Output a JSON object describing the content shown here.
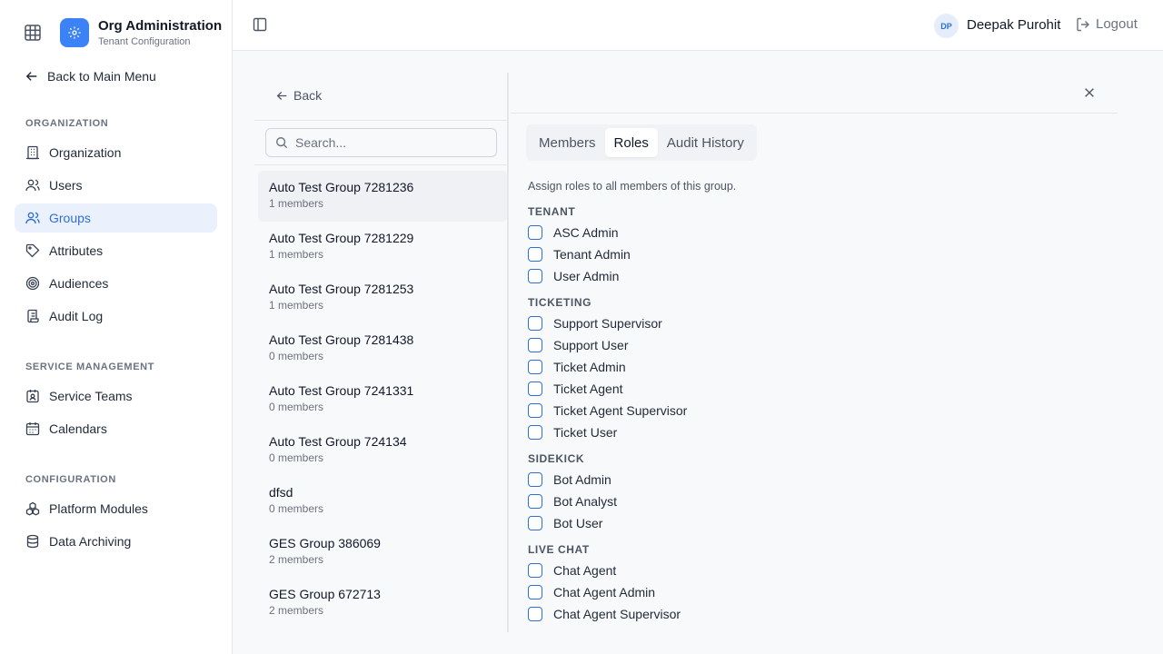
{
  "app": {
    "title": "Org Administration",
    "subtitle": "Tenant Configuration"
  },
  "sidebar": {
    "back_label": "Back to Main Menu",
    "sections": [
      {
        "label": "ORGANIZATION",
        "items": [
          {
            "label": "Organization",
            "icon": "building-icon"
          },
          {
            "label": "Users",
            "icon": "users-icon"
          },
          {
            "label": "Groups",
            "icon": "group-icon",
            "active": true
          },
          {
            "label": "Attributes",
            "icon": "tag-icon"
          },
          {
            "label": "Audiences",
            "icon": "target-icon"
          },
          {
            "label": "Audit Log",
            "icon": "scroll-icon"
          }
        ]
      },
      {
        "label": "SERVICE MANAGEMENT",
        "items": [
          {
            "label": "Service Teams",
            "icon": "team-badge-icon"
          },
          {
            "label": "Calendars",
            "icon": "calendar-icon"
          }
        ]
      },
      {
        "label": "CONFIGURATION",
        "items": [
          {
            "label": "Platform Modules",
            "icon": "modules-icon"
          },
          {
            "label": "Data Archiving",
            "icon": "database-icon"
          }
        ]
      }
    ]
  },
  "header": {
    "user_initials": "DP",
    "user_name": "Deepak Purohit",
    "logout_label": "Logout"
  },
  "list": {
    "back_label": "Back",
    "search_placeholder": "Search...",
    "groups": [
      {
        "name": "Auto Test Group 7281236",
        "members": "1 members",
        "selected": true
      },
      {
        "name": "Auto Test Group 7281229",
        "members": "1 members"
      },
      {
        "name": "Auto Test Group 7281253",
        "members": "1 members"
      },
      {
        "name": "Auto Test Group 7281438",
        "members": "0 members"
      },
      {
        "name": "Auto Test Group 7241331",
        "members": "0 members"
      },
      {
        "name": "Auto Test Group 724134",
        "members": "0 members"
      },
      {
        "name": "dfsd",
        "members": "0 members"
      },
      {
        "name": "GES Group 386069",
        "members": "2 members"
      },
      {
        "name": "GES Group 672713",
        "members": "2 members"
      }
    ]
  },
  "detail": {
    "tabs": [
      {
        "label": "Members"
      },
      {
        "label": "Roles",
        "active": true
      },
      {
        "label": "Audit History"
      }
    ],
    "description": "Assign roles to all members of this group.",
    "categories": [
      {
        "label": "TENANT",
        "roles": [
          "ASC Admin",
          "Tenant Admin",
          "User Admin"
        ]
      },
      {
        "label": "TICKETING",
        "roles": [
          "Support Supervisor",
          "Support User",
          "Ticket Admin",
          "Ticket Agent",
          "Ticket Agent Supervisor",
          "Ticket User"
        ]
      },
      {
        "label": "SIDEKICK",
        "roles": [
          "Bot Admin",
          "Bot Analyst",
          "Bot User"
        ]
      },
      {
        "label": "LIVE CHAT",
        "roles": [
          "Chat Agent",
          "Chat Agent Admin",
          "Chat Agent Supervisor"
        ]
      }
    ]
  },
  "colors": {
    "accent": "#2f6fd6",
    "brand_badge": "#3b82f6",
    "active_nav_bg": "#eaf1fd"
  }
}
